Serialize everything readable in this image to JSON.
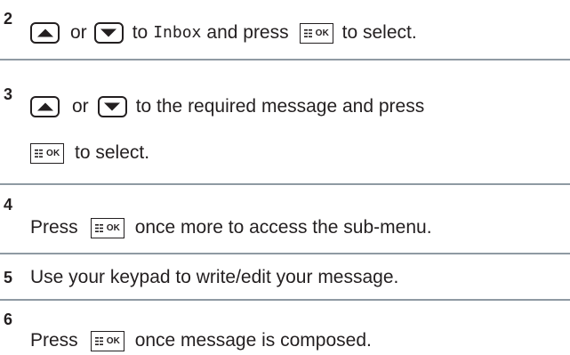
{
  "icons": {
    "up_key": "up-arrow-key-icon",
    "down_key": "down-arrow-key-icon",
    "menu_ok_key": "menu-ok-key-icon"
  },
  "ok_key_label": "OK",
  "steps": [
    {
      "number": "2",
      "or": "or",
      "text_a": "to",
      "mono_word": "Inbox",
      "text_b": "and press",
      "text_c": "to select."
    },
    {
      "number": "3",
      "or": "or",
      "text_a": "to the required message and press",
      "text_b": "to select."
    },
    {
      "number": "4",
      "text_a": "Press",
      "text_b": "once more to access the sub-menu."
    },
    {
      "number": "5",
      "text_a": "Use your keypad to write/edit your message."
    },
    {
      "number": "6",
      "text_a": "Press",
      "text_b": "once message is composed."
    }
  ],
  "colors": {
    "text": "#231f20",
    "separator": "#8f9aa3"
  }
}
